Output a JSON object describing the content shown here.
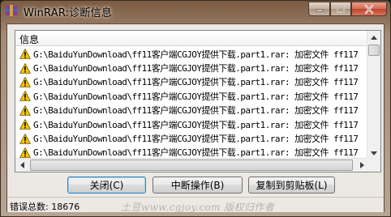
{
  "window": {
    "title": "WinRAR:诊断信息",
    "icon": "winrar-icon",
    "controls": [
      "minimize-icon",
      "maximize-icon",
      "close-icon"
    ]
  },
  "list": {
    "column_header": "信息",
    "row_icon": "warning-icon",
    "rows": [
      "G:\\BaiduYunDownload\\ff11客户端CGJOY提供下载.part1.rar: 加密文件 ff117",
      "G:\\BaiduYunDownload\\ff11客户端CGJOY提供下载.part1.rar: 加密文件 ff117",
      "G:\\BaiduYunDownload\\ff11客户端CGJOY提供下载.part1.rar: 加密文件 ff117",
      "G:\\BaiduYunDownload\\ff11客户端CGJOY提供下载.part1.rar: 加密文件 ff117",
      "G:\\BaiduYunDownload\\ff11客户端CGJOY提供下载.part1.rar: 加密文件 ff117",
      "G:\\BaiduYunDownload\\ff11客户端CGJOY提供下载.part1.rar: 加密文件 ff117",
      "G:\\BaiduYunDownload\\ff11客户端CGJOY提供下载.part1.rar: 加密文件 ff117",
      "G:\\BaiduYunDownload\\ff11客户端CGJOY提供下载.part1.rar: 加密文件 ff117"
    ]
  },
  "buttons": {
    "close": "关闭(C)",
    "abort": "中断操作(B)",
    "copy": "复制到剪贴板(L)"
  },
  "status": {
    "error_total": "错误总数: 18676",
    "watermark": "土豆www.cgjoy.com 版权归作者"
  },
  "colors": {
    "warning_fill": "#f5c400",
    "close_button": "#c2422a"
  }
}
